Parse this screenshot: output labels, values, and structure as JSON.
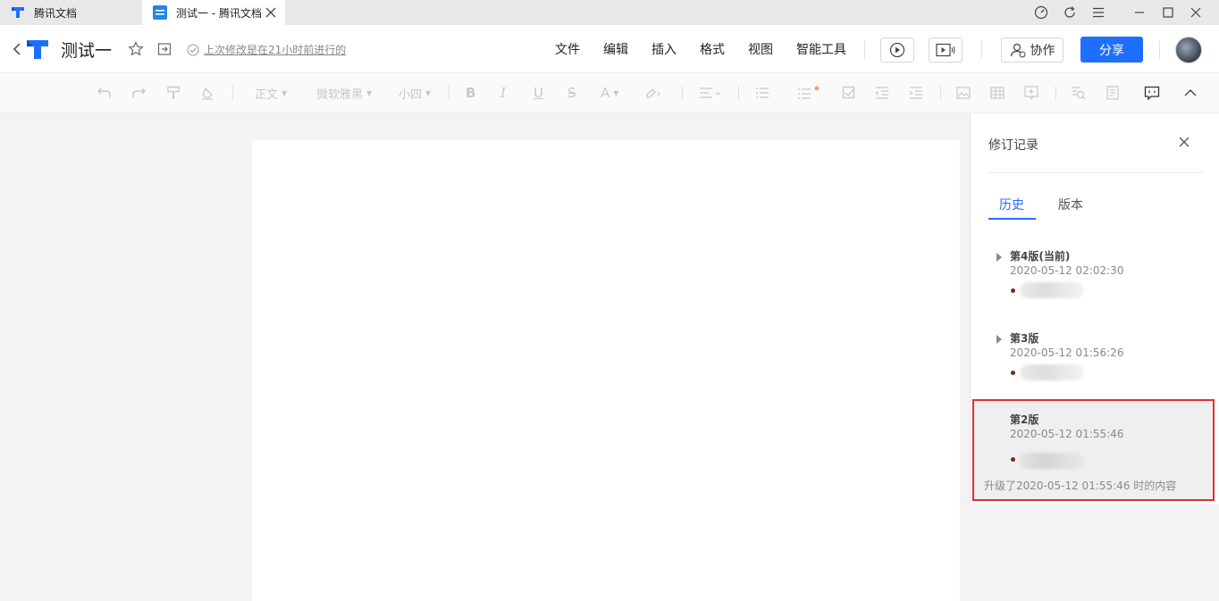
{
  "window": {
    "tabs": [
      {
        "label": "腾讯文档",
        "icon": "tencent-docs-logo-icon"
      },
      {
        "label": "测试一 - 腾讯文档",
        "icon": "doc-icon",
        "active": true
      }
    ],
    "controls": [
      "gauge-icon",
      "refresh-icon",
      "menu-icon",
      "minimize-icon",
      "maximize-icon",
      "close-icon"
    ]
  },
  "header": {
    "title": "测试一",
    "save_status": "上次修改是在21小时前进行的",
    "menu": [
      "文件",
      "编辑",
      "插入",
      "格式",
      "视图",
      "智能工具"
    ],
    "collab_label": "协作",
    "share_label": "分享"
  },
  "toolbar": {
    "style_label": "正文",
    "font_label": "微软雅黑",
    "size_label": "小四"
  },
  "panel": {
    "title": "修订记录",
    "tabs": [
      "历史",
      "版本"
    ],
    "versions": [
      {
        "name": "第4版(当前)",
        "time": "2020-05-12 02:02:30"
      },
      {
        "name": "第3版",
        "time": "2020-05-12 01:56:26"
      },
      {
        "name": "第2版",
        "time": "2020-05-12 01:55:46",
        "note": "升级了2020-05-12 01:55:46 时的内容"
      }
    ]
  },
  "colors": {
    "accent": "#1e6fff",
    "highlight_border": "#e03030"
  }
}
